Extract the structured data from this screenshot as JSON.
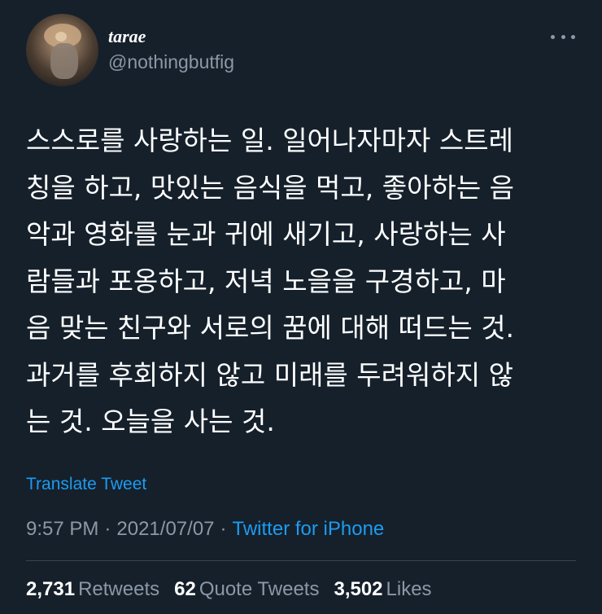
{
  "author": {
    "display_name": "tarae",
    "handle": "@nothingbutfig"
  },
  "tweet": {
    "text": "스스로를 사랑하는 일. 일어나자마자 스트레\n칭을 하고, 맛있는 음식을 먹고, 좋아하는 음\n악과 영화를 눈과 귀에 새기고, 사랑하는 사\n람들과 포옹하고, 저녁 노을을 구경하고, 마\n음 맞는 친구와 서로의 꿈에 대해 떠드는 것.\n과거를 후회하지 않고 미래를 두려워하지 않\n는 것. 오늘을 사는 것.",
    "translate_label": "Translate Tweet"
  },
  "meta": {
    "time": "9:57 PM",
    "separator": "·",
    "date": "2021/07/07",
    "source": "Twitter for iPhone"
  },
  "stats": {
    "retweets_count": "2,731",
    "retweets_label": "Retweets",
    "quotes_count": "62",
    "quotes_label": "Quote Tweets",
    "likes_count": "3,502",
    "likes_label": "Likes"
  },
  "icons": {
    "more": "more-horizontal-icon"
  },
  "colors": {
    "background": "#15202b",
    "accent": "#1d9bf0",
    "secondary_text": "#8b98a5",
    "divider": "#38444d"
  }
}
